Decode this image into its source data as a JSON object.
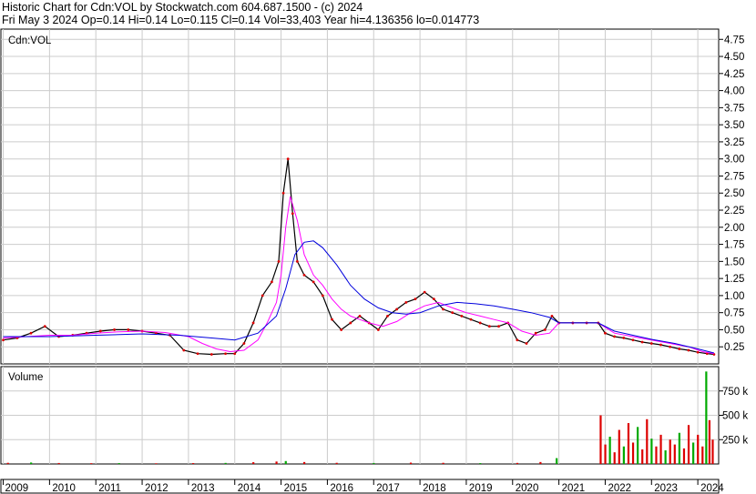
{
  "header": {
    "line1": "Historic Chart for Cdn:VOL by Stockwatch.com 604.687.1500 - (c) 2024",
    "line2": "Fri May  3 2024  Op=0.14  Hi=0.14  Lo=0.115  Cl=0.14  Vol=33,403  Year hi=4.136356  lo=0.014773"
  },
  "colors": {
    "price": "#000000",
    "down": "#dd0000",
    "up": "#00aa00",
    "ma_short": "#ff00ff",
    "ma_long": "#0000dd",
    "grid": "#cccccc"
  },
  "chart_data": [
    {
      "type": "line",
      "title": "Cdn:VOL",
      "ylim": [
        0,
        4.9
      ],
      "y_ticks": [
        "0.25",
        "0.50",
        "0.75",
        "1.00",
        "1.25",
        "1.50",
        "1.75",
        "2.00",
        "2.25",
        "2.50",
        "2.75",
        "3.00",
        "3.25",
        "3.50",
        "3.75",
        "4.00",
        "4.25",
        "4.50",
        "4.75"
      ],
      "x_labels": [
        "2009",
        "2010",
        "2011",
        "2012",
        "2013",
        "2014",
        "2015",
        "2016",
        "2017",
        "2018",
        "2019",
        "2020",
        "2021",
        "2022",
        "2023",
        "2024"
      ],
      "xlim": [
        2008.95,
        2024.45
      ],
      "grid": true,
      "series": [
        {
          "id": "price",
          "x": [
            2009.0,
            2009.3,
            2009.6,
            2009.9,
            2010.2,
            2010.5,
            2010.8,
            2011.1,
            2011.4,
            2011.7,
            2012.0,
            2012.3,
            2012.6,
            2012.9,
            2013.2,
            2013.5,
            2013.8,
            2014.0,
            2014.2,
            2014.4,
            2014.6,
            2014.8,
            2014.95,
            2015.05,
            2015.15,
            2015.25,
            2015.35,
            2015.5,
            2015.7,
            2015.9,
            2016.1,
            2016.3,
            2016.5,
            2016.7,
            2016.9,
            2017.1,
            2017.3,
            2017.5,
            2017.7,
            2017.9,
            2018.1,
            2018.3,
            2018.5,
            2018.7,
            2018.9,
            2019.1,
            2019.3,
            2019.5,
            2019.7,
            2019.9,
            2020.1,
            2020.3,
            2020.5,
            2020.7,
            2020.85,
            2021.0,
            2021.3,
            2021.6,
            2021.85,
            2022.0,
            2022.2,
            2022.4,
            2022.6,
            2022.8,
            2023.0,
            2023.2,
            2023.4,
            2023.6,
            2023.8,
            2024.0,
            2024.2,
            2024.35
          ],
          "values": [
            0.35,
            0.38,
            0.45,
            0.55,
            0.4,
            0.42,
            0.45,
            0.48,
            0.5,
            0.5,
            0.48,
            0.45,
            0.42,
            0.2,
            0.15,
            0.14,
            0.15,
            0.15,
            0.3,
            0.6,
            1.0,
            1.2,
            1.5,
            2.5,
            3.0,
            2.2,
            1.5,
            1.3,
            1.2,
            1.0,
            0.65,
            0.5,
            0.6,
            0.7,
            0.6,
            0.5,
            0.7,
            0.8,
            0.9,
            0.95,
            1.05,
            0.95,
            0.8,
            0.75,
            0.7,
            0.65,
            0.6,
            0.55,
            0.55,
            0.6,
            0.35,
            0.3,
            0.45,
            0.5,
            0.7,
            0.6,
            0.6,
            0.6,
            0.6,
            0.45,
            0.4,
            0.38,
            0.35,
            0.32,
            0.3,
            0.28,
            0.25,
            0.22,
            0.2,
            0.17,
            0.15,
            0.14
          ]
        },
        {
          "id": "ma_short",
          "x": [
            2009.0,
            2009.5,
            2010.0,
            2010.5,
            2011.0,
            2011.5,
            2012.0,
            2012.5,
            2013.0,
            2013.3,
            2013.6,
            2013.9,
            2014.2,
            2014.5,
            2014.7,
            2014.9,
            2015.0,
            2015.1,
            2015.2,
            2015.35,
            2015.5,
            2015.7,
            2015.9,
            2016.1,
            2016.3,
            2016.5,
            2016.7,
            2016.9,
            2017.2,
            2017.5,
            2017.8,
            2018.1,
            2018.4,
            2018.7,
            2019.0,
            2019.3,
            2019.6,
            2019.9,
            2020.2,
            2020.5,
            2020.8,
            2021.0,
            2021.85,
            2022.2,
            2022.6,
            2023.0,
            2023.4,
            2023.8,
            2024.1,
            2024.35
          ],
          "values": [
            0.38,
            0.4,
            0.42,
            0.42,
            0.45,
            0.47,
            0.48,
            0.46,
            0.4,
            0.3,
            0.22,
            0.18,
            0.2,
            0.35,
            0.6,
            0.9,
            1.3,
            2.0,
            2.45,
            2.1,
            1.6,
            1.3,
            1.15,
            0.95,
            0.8,
            0.7,
            0.65,
            0.6,
            0.55,
            0.62,
            0.75,
            0.85,
            0.9,
            0.82,
            0.75,
            0.7,
            0.65,
            0.6,
            0.48,
            0.42,
            0.45,
            0.6,
            0.6,
            0.45,
            0.4,
            0.35,
            0.3,
            0.25,
            0.18,
            0.15
          ]
        },
        {
          "id": "ma_long",
          "x": [
            2009.0,
            2010.0,
            2011.0,
            2012.0,
            2012.8,
            2013.5,
            2014.0,
            2014.5,
            2014.9,
            2015.1,
            2015.3,
            2015.5,
            2015.7,
            2015.9,
            2016.2,
            2016.5,
            2016.8,
            2017.1,
            2017.4,
            2017.7,
            2018.0,
            2018.4,
            2018.8,
            2019.2,
            2019.6,
            2020.0,
            2020.4,
            2020.8,
            2021.0,
            2021.85,
            2022.2,
            2022.6,
            2023.0,
            2023.5,
            2024.0,
            2024.35
          ],
          "values": [
            0.4,
            0.4,
            0.42,
            0.44,
            0.42,
            0.38,
            0.35,
            0.45,
            0.7,
            1.1,
            1.6,
            1.78,
            1.8,
            1.7,
            1.45,
            1.15,
            0.95,
            0.82,
            0.75,
            0.73,
            0.75,
            0.85,
            0.9,
            0.88,
            0.85,
            0.8,
            0.75,
            0.68,
            0.6,
            0.6,
            0.48,
            0.42,
            0.36,
            0.3,
            0.22,
            0.16
          ]
        }
      ]
    },
    {
      "type": "bar",
      "title": "Volume",
      "ylim": [
        0,
        1000000
      ],
      "y_ticks": [
        "250 k",
        "500 k",
        "750 k"
      ],
      "bars": [
        {
          "x": 2009.1,
          "v": 12000
        },
        {
          "x": 2009.6,
          "v": 15000
        },
        {
          "x": 2010.2,
          "v": 10000
        },
        {
          "x": 2010.9,
          "v": 8000
        },
        {
          "x": 2011.5,
          "v": 9000
        },
        {
          "x": 2012.3,
          "v": 7000
        },
        {
          "x": 2013.1,
          "v": 9000
        },
        {
          "x": 2013.8,
          "v": 11000
        },
        {
          "x": 2014.4,
          "v": 18000
        },
        {
          "x": 2014.9,
          "v": 25000
        },
        {
          "x": 2015.1,
          "v": 30000
        },
        {
          "x": 2015.5,
          "v": 20000
        },
        {
          "x": 2016.2,
          "v": 12000
        },
        {
          "x": 2017.0,
          "v": 10000
        },
        {
          "x": 2017.8,
          "v": 14000
        },
        {
          "x": 2018.5,
          "v": 12000
        },
        {
          "x": 2019.3,
          "v": 9000
        },
        {
          "x": 2020.1,
          "v": 11000
        },
        {
          "x": 2020.6,
          "v": 20000
        },
        {
          "x": 2020.95,
          "v": 60000
        },
        {
          "x": 2021.9,
          "v": 500000
        },
        {
          "x": 2022.0,
          "v": 200000
        },
        {
          "x": 2022.1,
          "v": 280000
        },
        {
          "x": 2022.2,
          "v": 120000
        },
        {
          "x": 2022.3,
          "v": 350000
        },
        {
          "x": 2022.4,
          "v": 180000
        },
        {
          "x": 2022.5,
          "v": 420000
        },
        {
          "x": 2022.6,
          "v": 220000
        },
        {
          "x": 2022.7,
          "v": 380000
        },
        {
          "x": 2022.8,
          "v": 150000
        },
        {
          "x": 2022.9,
          "v": 460000
        },
        {
          "x": 2023.0,
          "v": 260000
        },
        {
          "x": 2023.1,
          "v": 180000
        },
        {
          "x": 2023.2,
          "v": 300000
        },
        {
          "x": 2023.3,
          "v": 140000
        },
        {
          "x": 2023.4,
          "v": 250000
        },
        {
          "x": 2023.5,
          "v": 200000
        },
        {
          "x": 2023.6,
          "v": 320000
        },
        {
          "x": 2023.7,
          "v": 160000
        },
        {
          "x": 2023.8,
          "v": 400000
        },
        {
          "x": 2023.9,
          "v": 220000
        },
        {
          "x": 2024.0,
          "v": 300000
        },
        {
          "x": 2024.1,
          "v": 180000
        },
        {
          "x": 2024.18,
          "v": 950000
        },
        {
          "x": 2024.25,
          "v": 450000
        },
        {
          "x": 2024.32,
          "v": 250000
        }
      ]
    }
  ]
}
